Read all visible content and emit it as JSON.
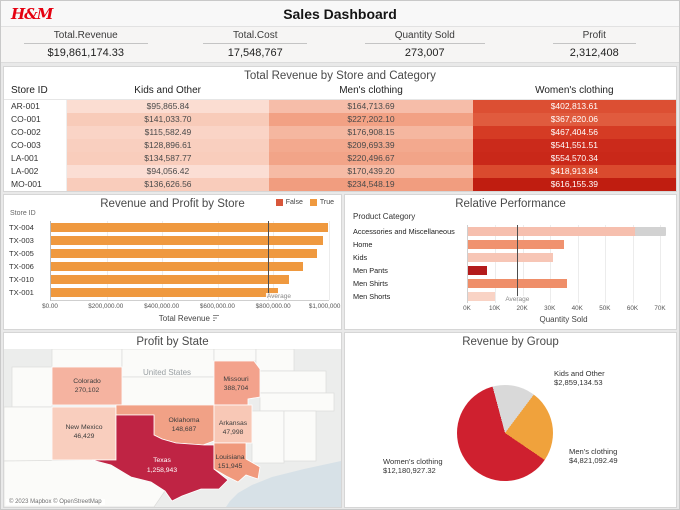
{
  "header": {
    "logo": "H&M",
    "title": "Sales Dashboard"
  },
  "kpis": [
    {
      "label": "Total.Revenue",
      "value": "$19,861,174.33"
    },
    {
      "label": "Total.Cost",
      "value": "17,548,767"
    },
    {
      "label": "Quantity Sold",
      "value": "273,007"
    },
    {
      "label": "Profit",
      "value": "2,312,408"
    }
  ],
  "heatmap": {
    "title": "Total Revenue by Store and Category",
    "columns": [
      "Store ID",
      "Kids and Other",
      "Men's clothing",
      "Women's clothing"
    ],
    "rows": [
      {
        "store": "AR-001",
        "cells": [
          {
            "text": "$95,865.84",
            "bg": "#fbddd2",
            "fg": "#4a4a4a"
          },
          {
            "text": "$164,713.69",
            "bg": "#f6bda9",
            "fg": "#4a4a4a"
          },
          {
            "text": "$402,813.61",
            "bg": "#dc4f33",
            "fg": "#ffffff"
          }
        ]
      },
      {
        "store": "CO-001",
        "cells": [
          {
            "text": "$141,033.70",
            "bg": "#f8cbb9",
            "fg": "#4a4a4a"
          },
          {
            "text": "$227,202.10",
            "bg": "#f2a184",
            "fg": "#4a4a4a"
          },
          {
            "text": "$367,620.06",
            "bg": "#e05b3e",
            "fg": "#ffffff"
          }
        ]
      },
      {
        "store": "CO-002",
        "cells": [
          {
            "text": "$115,582.49",
            "bg": "#fad4c6",
            "fg": "#4a4a4a"
          },
          {
            "text": "$176,908.15",
            "bg": "#f5b7a0",
            "fg": "#4a4a4a"
          },
          {
            "text": "$467,404.56",
            "bg": "#d53b24",
            "fg": "#ffffff"
          }
        ]
      },
      {
        "store": "CO-003",
        "cells": [
          {
            "text": "$128,896.61",
            "bg": "#f9cfbf",
            "fg": "#4a4a4a"
          },
          {
            "text": "$209,693.39",
            "bg": "#f3a98e",
            "fg": "#4a4a4a"
          },
          {
            "text": "$541,551.51",
            "bg": "#cb2a1b",
            "fg": "#ffffff"
          }
        ]
      },
      {
        "store": "LA-001",
        "cells": [
          {
            "text": "$134,587.77",
            "bg": "#f9cdbc",
            "fg": "#4a4a4a"
          },
          {
            "text": "$220,496.67",
            "bg": "#f2a488",
            "fg": "#4a4a4a"
          },
          {
            "text": "$554,570.34",
            "bg": "#c92819",
            "fg": "#ffffff"
          }
        ]
      },
      {
        "store": "LA-002",
        "cells": [
          {
            "text": "$94,056.42",
            "bg": "#fbded4",
            "fg": "#4a4a4a"
          },
          {
            "text": "$170,439.20",
            "bg": "#f6bba5",
            "fg": "#4a4a4a"
          },
          {
            "text": "$418,913.84",
            "bg": "#da4a2e",
            "fg": "#ffffff"
          }
        ]
      },
      {
        "store": "MO-001",
        "cells": [
          {
            "text": "$136,626.56",
            "bg": "#f9ccbb",
            "fg": "#4a4a4a"
          },
          {
            "text": "$234,548.19",
            "bg": "#f19d7f",
            "fg": "#4a4a4a"
          },
          {
            "text": "$616,155.39",
            "bg": "#c01d10",
            "fg": "#ffffff"
          }
        ]
      }
    ]
  },
  "revenue_chart": {
    "title": "Revenue and Profit by Store",
    "y_header": "Store ID",
    "legend": [
      {
        "label": "False",
        "color": "#d8573b"
      },
      {
        "label": "True",
        "color": "#ef993f"
      }
    ],
    "bar_color": "#ef993f",
    "ticks": [
      "$0.00",
      "$200,000.00",
      "$400,000.00",
      "$600,000.00",
      "$800,000.00",
      "$1,000,000.00"
    ],
    "xlabel": "Total Revenue"
  },
  "perf_chart": {
    "title": "Relative Performance",
    "col_header": "Product Category",
    "ticks": [
      "0K",
      "10K",
      "20K",
      "30K",
      "40K",
      "50K",
      "60K",
      "70K"
    ],
    "xlabel": "Quantity Sold"
  },
  "map": {
    "title": "Profit by State",
    "country_label": "United States",
    "attribution": "© 2023 Mapbox © OpenStreetMap",
    "states": [
      {
        "name": "Colorado",
        "value": "270,102",
        "fill": "#f5b3a0"
      },
      {
        "name": "New Mexico",
        "value": "46,429",
        "fill": "#f9cebe"
      },
      {
        "name": "Oklahoma",
        "value": "148,687",
        "fill": "#f1a186"
      },
      {
        "name": "Texas",
        "value": "1,258,943",
        "fill": "#bf2444"
      },
      {
        "name": "Missouri",
        "value": "388,704",
        "fill": "#f3a28c"
      },
      {
        "name": "Arkansas",
        "value": "47,998",
        "fill": "#f8c8b6"
      },
      {
        "name": "Louisiana",
        "value": "151,945",
        "fill": "#f0997c"
      }
    ]
  },
  "pie_chart": {
    "title": "Revenue by Group",
    "labels": [
      {
        "name": "Kids and Other",
        "value": "$2,859,134.53"
      },
      {
        "name": "Men's clothing",
        "value": "$4,821,092.49"
      },
      {
        "name": "Women's clothing",
        "value": "$12,180,927.32"
      }
    ]
  },
  "chart_data": [
    {
      "type": "heatmap",
      "title": "Total Revenue by Store and Category",
      "rows": [
        "AR-001",
        "CO-001",
        "CO-002",
        "CO-003",
        "LA-001",
        "LA-002",
        "MO-001"
      ],
      "columns": [
        "Kids and Other",
        "Men's clothing",
        "Women's clothing"
      ],
      "values": [
        [
          95865.84,
          164713.69,
          402813.61
        ],
        [
          141033.7,
          227202.1,
          367620.06
        ],
        [
          115582.49,
          176908.15,
          467404.56
        ],
        [
          128896.61,
          209693.39,
          541551.51
        ],
        [
          134587.77,
          220496.67,
          554570.34
        ],
        [
          94056.42,
          170439.2,
          418913.84
        ],
        [
          136626.56,
          234548.19,
          616155.39
        ]
      ]
    },
    {
      "type": "bar",
      "orientation": "horizontal",
      "title": "Revenue and Profit by Store",
      "categories": [
        "TX-004",
        "TX-003",
        "TX-005",
        "TX-006",
        "TX-010",
        "TX-001"
      ],
      "values": [
        995000,
        980000,
        958000,
        905000,
        855000,
        818000
      ],
      "xlabel": "Total Revenue",
      "xlim": [
        0,
        1000000
      ],
      "reference": {
        "label": "Average",
        "value": 780000
      },
      "legend": [
        "False",
        "True"
      ]
    },
    {
      "type": "bar",
      "orientation": "horizontal",
      "title": "Relative Performance",
      "categories": [
        "Accessories and Miscellaneous",
        "Home",
        "Kids",
        "Men Pants",
        "Men Shirts",
        "Men Shorts"
      ],
      "values": [
        68000,
        35000,
        31000,
        7000,
        36000,
        10000
      ],
      "colors": [
        "#f6bfae",
        "#f0926f",
        "#f7c6b6",
        "#b31b1b",
        "#ef8e69",
        "#f9d3c5"
      ],
      "xlabel": "Quantity Sold",
      "xlim": [
        0,
        70000
      ],
      "reference": {
        "label": "Average",
        "value": 18000
      }
    },
    {
      "type": "choropleth",
      "title": "Profit by State",
      "data": [
        {
          "state": "Colorado",
          "profit": 270102
        },
        {
          "state": "New Mexico",
          "profit": 46429
        },
        {
          "state": "Oklahoma",
          "profit": 148687
        },
        {
          "state": "Texas",
          "profit": 1258943
        },
        {
          "state": "Missouri",
          "profit": 388704
        },
        {
          "state": "Arkansas",
          "profit": 47998
        },
        {
          "state": "Louisiana",
          "profit": 151945
        }
      ]
    },
    {
      "type": "pie",
      "title": "Revenue by Group",
      "labels": [
        "Kids and Other",
        "Men's clothing",
        "Women's clothing"
      ],
      "values": [
        2859134.53,
        4821092.49,
        12180927.32
      ],
      "colors": [
        "#d9d9d9",
        "#f0a23c",
        "#cf202f"
      ],
      "start_angle_deg": -15
    }
  ]
}
